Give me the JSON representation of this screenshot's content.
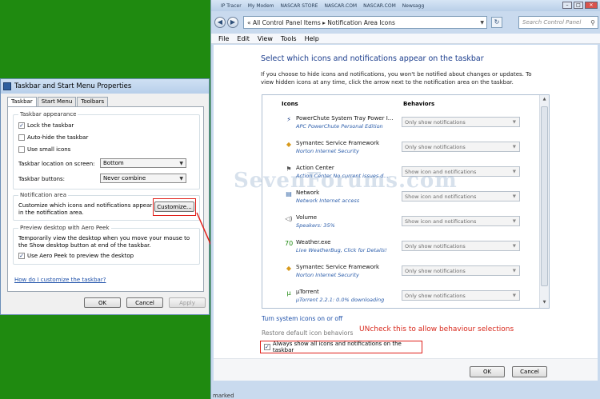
{
  "taskbar_dialog": {
    "title": "Taskbar and Start Menu Properties",
    "tabs": [
      "Taskbar",
      "Start Menu",
      "Toolbars"
    ],
    "appearance_group": "Taskbar appearance",
    "lock_taskbar": "Lock the taskbar",
    "auto_hide": "Auto-hide the taskbar",
    "small_icons": "Use small icons",
    "location_label": "Taskbar location on screen:",
    "location_value": "Bottom",
    "buttons_label": "Taskbar buttons:",
    "buttons_value": "Never combine",
    "notif_group": "Notification area",
    "notif_desc": "Customize which icons and notifications appear in the notification area.",
    "customize_button": "Customize...",
    "peek_group": "Preview desktop with Aero Peek",
    "peek_desc": "Temporarily view the desktop when you move your mouse to the Show desktop button at end of the taskbar.",
    "peek_checkbox": "Use Aero Peek to preview the desktop",
    "help_link": "How do I customize the taskbar?",
    "ok": "OK",
    "cancel": "Cancel",
    "apply": "Apply"
  },
  "control_panel": {
    "browser_tabs": [
      "IP Tracer",
      "My Modem",
      "NASCAR STORE",
      "NASCAR.COM",
      "NASCAR.COM",
      "Newsagg"
    ],
    "address": "« All Control Panel Items ▸ Notification Area Icons",
    "search_placeholder": "Search Control Panel",
    "menu": [
      "File",
      "Edit",
      "View",
      "Tools",
      "Help"
    ],
    "heading": "Select which icons and notifications appear on the taskbar",
    "description": "If you choose to hide icons and notifications, you won't be notified about changes or updates. To view hidden icons at any time, click the arrow next to the notification area on the taskbar.",
    "col_icons": "Icons",
    "col_behaviors": "Behaviors",
    "rows": [
      {
        "name": "PowerChute System Tray Power I...",
        "sub": "APC PowerChute Personal Edition",
        "behavior": "Only show notifications",
        "icon": "⚡",
        "color": "#1d3f8a"
      },
      {
        "name": "Symantec Service Framework",
        "sub": "Norton Internet Security",
        "behavior": "Only show notifications",
        "icon": "◆",
        "color": "#d89a1c"
      },
      {
        "name": "Action Center",
        "sub": "Action Center  No current issues d...",
        "behavior": "Show icon and notifications",
        "icon": "⚑",
        "color": "#555555"
      },
      {
        "name": "Network",
        "sub": "Network Internet access",
        "behavior": "Show icon and notifications",
        "icon": "▤",
        "color": "#3a6aa8"
      },
      {
        "name": "Volume",
        "sub": "Speakers: 35%",
        "behavior": "Show icon and notifications",
        "icon": "◁)",
        "color": "#555555"
      },
      {
        "name": "Weather.exe",
        "sub": "Live WeatherBug, Click for Details!",
        "behavior": "Only show notifications",
        "icon": "70",
        "color": "#1f8a10"
      },
      {
        "name": "Symantec Service Framework",
        "sub": "Norton Internet Security",
        "behavior": "Only show notifications",
        "icon": "◆",
        "color": "#d89a1c"
      },
      {
        "name": "µTorrent",
        "sub": "µTorrent 2.2.1: 0.0% downloading",
        "behavior": "Only show notifications",
        "icon": "µ",
        "color": "#1f8a10"
      }
    ],
    "watermark": "SevenForums.com",
    "turn_system_icons": "Turn system icons on or off",
    "restore_default": "Restore default icon behaviors",
    "annotation": "UNcheck this to allow behaviour selections",
    "always_show": "Always show all icons and notifications on the taskbar",
    "ok": "OK",
    "cancel": "Cancel",
    "status_text": "marked"
  }
}
